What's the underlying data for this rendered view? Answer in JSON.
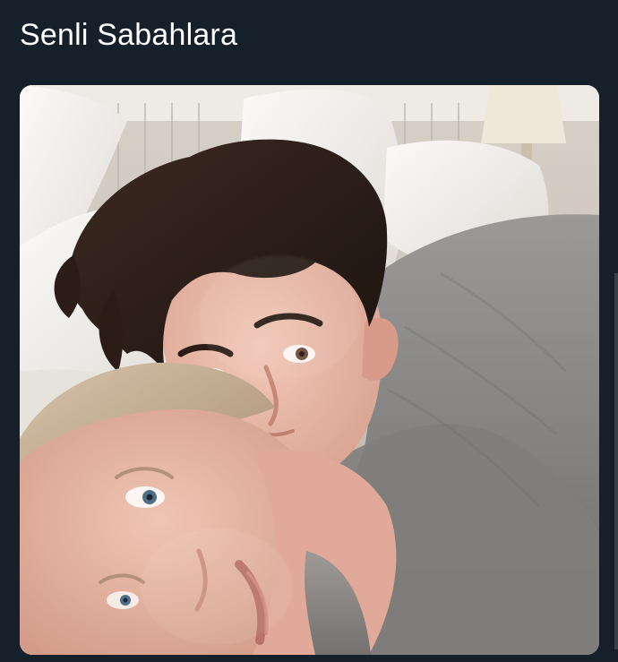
{
  "post": {
    "text": "Senli Sabahlara",
    "media": {
      "alt_icon": "photo-icon",
      "colors": {
        "background": "#15202b",
        "text": "#ffffff",
        "bedding": "#f4f2ef",
        "robe": "#8e8d8c",
        "hair_dark": "#2a1c16",
        "hair_light": "#c8b49a",
        "skin": "#e7b9a7"
      }
    }
  }
}
